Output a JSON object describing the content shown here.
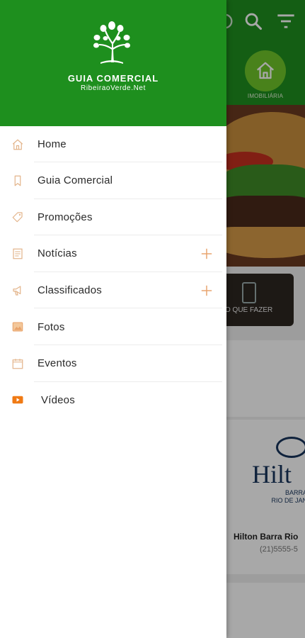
{
  "background": {
    "category_label": "IMOBILIÁRIA",
    "promo_label": "O QUE FAZER",
    "listing_name": "Hilton Barra Rio",
    "listing_phone": "(21)5555-5",
    "hilton_logo_word": "Hilt",
    "hilton_logo_sub1": "BARRA",
    "hilton_logo_sub2": "RIO DE JAN"
  },
  "drawer": {
    "brand_title": "GUIA COMERCIAL",
    "brand_subtitle": "RibeiraoVerde.Net",
    "items": [
      {
        "label": "Home",
        "icon": "home-icon"
      },
      {
        "label": "Guia Comercial",
        "icon": "bookmark-icon"
      },
      {
        "label": "Promoções",
        "icon": "tag-icon"
      },
      {
        "label": "Notícias",
        "icon": "newspaper-icon",
        "expandable": true
      },
      {
        "label": "Classificados",
        "icon": "megaphone-icon",
        "expandable": true
      },
      {
        "label": "Fotos",
        "icon": "photo-icon"
      },
      {
        "label": "Eventos",
        "icon": "calendar-icon"
      },
      {
        "label": "Vídeos",
        "icon": "video-play-icon"
      }
    ]
  },
  "colors": {
    "brand_green": "#1e8f1e",
    "accent_orange": "#e8a26a",
    "video_orange": "#f07a14"
  }
}
